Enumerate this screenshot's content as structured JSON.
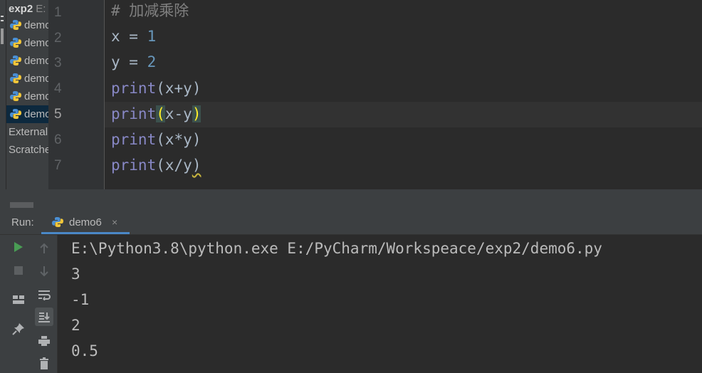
{
  "project": {
    "root_name": "exp2",
    "root_path_hint": "E:",
    "files": [
      {
        "label": "demo"
      },
      {
        "label": "demo"
      },
      {
        "label": "demo"
      },
      {
        "label": "demo"
      },
      {
        "label": "demo"
      },
      {
        "label": "demo",
        "selected": true
      }
    ],
    "external_label": "External",
    "scratches_label": "Scratche"
  },
  "editor": {
    "line_numbers": [
      "1",
      "2",
      "3",
      "4",
      "5",
      "6",
      "7"
    ],
    "current_line": 5,
    "lines": [
      {
        "comment": "# 加减乘除"
      },
      {
        "var": "x",
        "op": " = ",
        "num": "1"
      },
      {
        "var": "y",
        "op": " = ",
        "num": "2"
      },
      {
        "fn": "print",
        "open": "(",
        "args": "x+y",
        "close": ")"
      },
      {
        "fn": "print",
        "open": "(",
        "args": "x-y",
        "close": ")"
      },
      {
        "fn": "print",
        "open": "(",
        "args": "x*y",
        "close": ")"
      },
      {
        "fn": "print",
        "open": "(",
        "args": "x/y",
        "close": ")"
      }
    ]
  },
  "run_panel": {
    "label": "Run:",
    "tab_label": "demo6",
    "close_glyph": "×"
  },
  "console": {
    "lines": [
      "E:\\Python3.8\\python.exe E:/PyCharm/Workspeace/exp2/demo6.py",
      "3",
      "-1",
      "2",
      "0.5"
    ]
  },
  "icons": {
    "toolbar_1": [
      "run-icon",
      "stop-icon",
      "layout-icon",
      "pin-icon"
    ],
    "toolbar_2": [
      "up-arrow-icon",
      "down-arrow-icon",
      "soft-wrap-icon",
      "scroll-to-end-icon",
      "print-icon",
      "trash-icon"
    ]
  },
  "colors": {
    "run_green": "#499c54",
    "number_blue": "#6897bb",
    "builtin_purple": "#8888c6",
    "paren_yellow": "#ffef28",
    "tab_underline": "#4a88c7"
  }
}
